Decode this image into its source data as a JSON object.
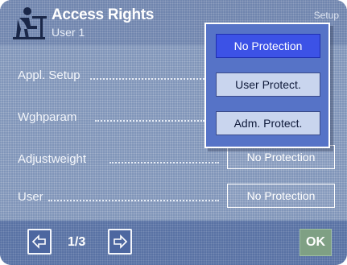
{
  "header": {
    "title": "Access Rights",
    "subtitle": "User 1",
    "right_label": "Setup"
  },
  "rows": [
    {
      "label": "Appl. Setup",
      "value": ""
    },
    {
      "label": "Wghparam",
      "value": ""
    },
    {
      "label": "Adjustweight",
      "value": "No Protection"
    },
    {
      "label": "User",
      "value": "No Protection"
    }
  ],
  "popup": {
    "options": [
      "No Protection",
      "User Protect.",
      "Adm. Protect."
    ],
    "selected": "No Protection"
  },
  "bottom": {
    "page_indicator": "1/3",
    "ok_label": "OK"
  },
  "colors": {
    "background": "#7f94b8",
    "popup": "#5673c7",
    "selected_option": "#3c52e6",
    "ok_button": "#7fa084"
  },
  "icons": [
    "user-at-desk-icon",
    "arrow-left-icon",
    "arrow-right-icon"
  ]
}
